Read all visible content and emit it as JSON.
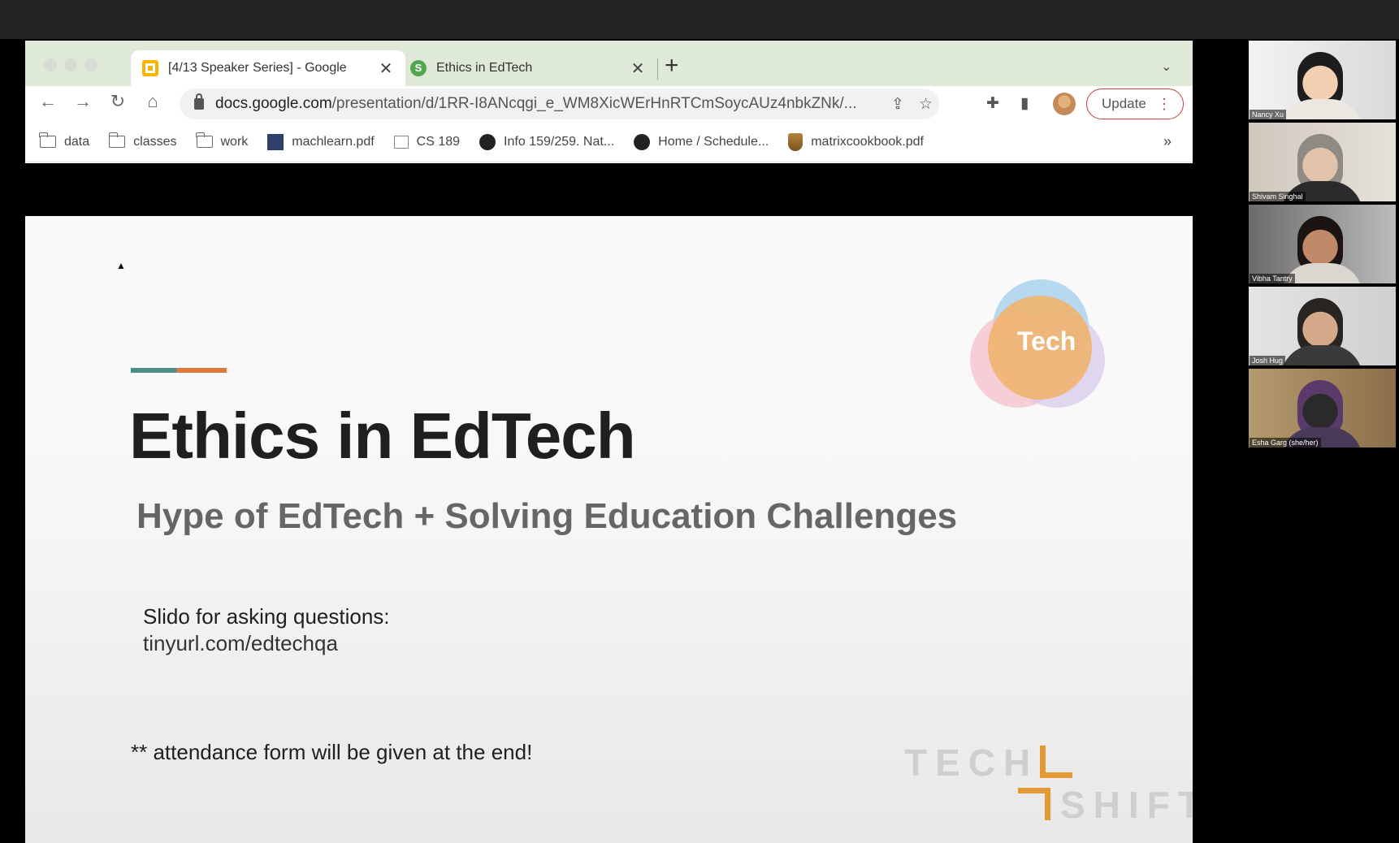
{
  "browser": {
    "tabs": [
      {
        "title": "[4/13 Speaker Series] - Google",
        "favicon": "google-slides-icon",
        "active": true
      },
      {
        "title": "Ethics in EdTech",
        "favicon": "slido-icon",
        "active": false
      }
    ],
    "new_tab_symbol": "+",
    "tab_menu_symbol": "⌄",
    "url_host": "docs.google.com",
    "url_path": "/presentation/d/1RR-I8ANcqgi_e_WM8XicWErHnRTCmSoycAUz4nbkZNk/...",
    "update_label": "Update",
    "bookmarks": [
      {
        "label": "data",
        "icon": "folder-icon"
      },
      {
        "label": "classes",
        "icon": "folder-icon"
      },
      {
        "label": "work",
        "icon": "folder-icon"
      },
      {
        "label": "machlearn.pdf",
        "icon": "pdf-thumbnail-icon"
      },
      {
        "label": "CS 189",
        "icon": "page-icon"
      },
      {
        "label": "Info 159/259. Nat...",
        "icon": "globe-icon"
      },
      {
        "label": "Home / Schedule...",
        "icon": "globe-icon"
      },
      {
        "label": "matrixcookbook.pdf",
        "icon": "crest-icon"
      }
    ],
    "bookmarks_overflow": "»"
  },
  "slide": {
    "title": "Ethics in EdTech",
    "subtitle": "Hype of EdTech + Solving Education Challenges",
    "slido_line1": "Slido for asking questions:",
    "slido_line2": "tinyurl.com/edtechqa",
    "attendance": "** attendance form will be given at the end!",
    "badge_text": "Tech",
    "brand_word1": "TECH",
    "brand_word2": "SHIFT",
    "colors": {
      "accent_teal": "#4b8d88",
      "accent_orange": "#e07a3c",
      "brand_orange": "#e39a34"
    }
  },
  "participants": [
    {
      "name": "Nancy Xu"
    },
    {
      "name": "Shivam Singhal"
    },
    {
      "name": "Vibha Tantry"
    },
    {
      "name": "Josh Hug"
    },
    {
      "name": "Esha Garg (she/her)"
    }
  ]
}
